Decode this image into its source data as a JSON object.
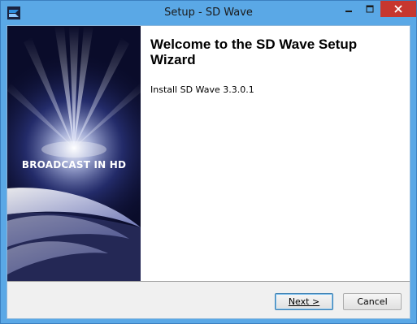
{
  "window": {
    "title": "Setup - SD Wave",
    "controls": {
      "minimize": "minimize-icon",
      "maximize": "maximize-icon",
      "close": "close-icon"
    }
  },
  "banner": {
    "text": "BROADCAST IN HD"
  },
  "main": {
    "heading": "Welcome to the SD Wave Setup Wizard",
    "subtitle": "Install SD Wave 3.3.0.1"
  },
  "buttons": {
    "next": "Next >",
    "cancel": "Cancel"
  },
  "colors": {
    "frame": "#5aa8e6",
    "close": "#c7372f",
    "banner_bg": "#0a0c2a",
    "bottom_bar": "#f0f0f0"
  }
}
